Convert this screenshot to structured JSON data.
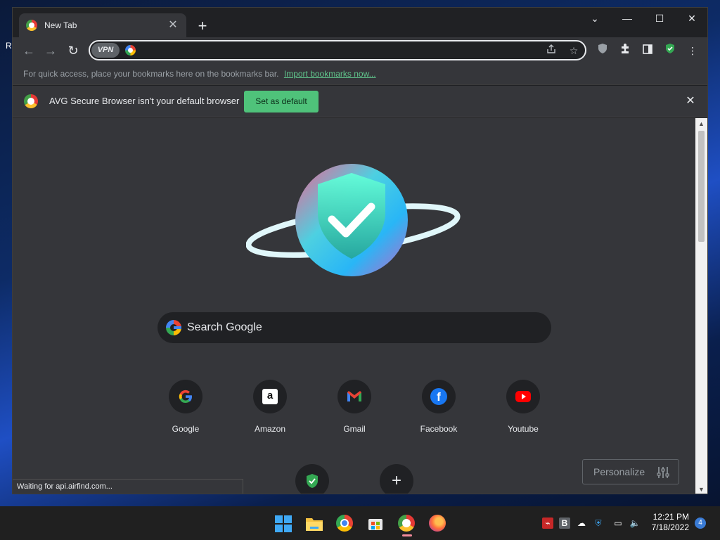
{
  "desktop": {
    "partial_label": "R"
  },
  "browser": {
    "tab": {
      "title": "New Tab",
      "close": "✕"
    },
    "new_tab": "+",
    "window_controls": {
      "tabsearch": "⌄",
      "minimize": "—",
      "maximize": "☐",
      "close": "✕"
    },
    "nav": {
      "back": "←",
      "forward": "→",
      "reload": "↻"
    },
    "omnibox": {
      "vpn_label": "VPN",
      "value": "",
      "placeholder": ""
    },
    "bookmarks_bar": {
      "hint": "For quick access, place your bookmarks here on the bookmarks bar.",
      "import_link": "Import bookmarks now..."
    },
    "infobar": {
      "message": "AVG Secure Browser isn't your default browser",
      "button": "Set as default",
      "close": "✕"
    },
    "ntp": {
      "search_placeholder": "Search Google",
      "shortcuts": [
        {
          "name": "Google",
          "icon": "google-icon"
        },
        {
          "name": "Amazon",
          "icon": "amazon-icon"
        },
        {
          "name": "Gmail",
          "icon": "gmail-icon"
        },
        {
          "name": "Facebook",
          "icon": "facebook-icon"
        },
        {
          "name": "Youtube",
          "icon": "youtube-icon"
        }
      ],
      "second_row": [
        {
          "name": "",
          "icon": "avg-shield-icon"
        },
        {
          "name": "",
          "icon": "add-shortcut-icon"
        }
      ],
      "personalize": "Personalize"
    },
    "status": "Waiting for api.airfind.com..."
  },
  "taskbar": {
    "apps": [
      "windows-start-icon",
      "file-explorer-icon",
      "chrome-icon",
      "microsoft-store-icon",
      "avg-browser-icon",
      "firefox-icon"
    ],
    "clock": {
      "time": "12:21 PM",
      "date": "7/18/2022"
    },
    "notifications": "4"
  },
  "colors": {
    "accent_green": "#4fc27a",
    "link_green": "#5fc28a",
    "bg_dark": "#202124",
    "bg_panel": "#35363a"
  }
}
